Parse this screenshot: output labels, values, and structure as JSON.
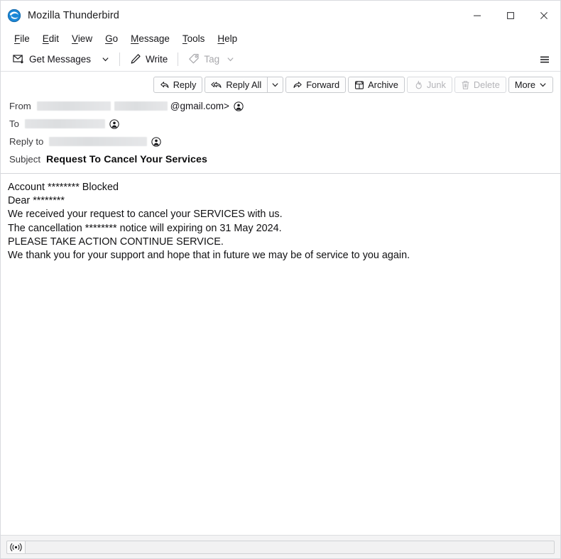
{
  "window": {
    "title": "Mozilla Thunderbird",
    "logo_icon": "thunderbird-logo-icon",
    "controls": {
      "minimize": "minimize-icon",
      "maximize": "maximize-icon",
      "close": "close-icon"
    }
  },
  "menubar": {
    "items": [
      {
        "label": "File",
        "accesskey": "F"
      },
      {
        "label": "Edit",
        "accesskey": "E"
      },
      {
        "label": "View",
        "accesskey": "V"
      },
      {
        "label": "Go",
        "accesskey": "G"
      },
      {
        "label": "Message",
        "accesskey": "M"
      },
      {
        "label": "Tools",
        "accesskey": "T"
      },
      {
        "label": "Help",
        "accesskey": "H"
      }
    ]
  },
  "toolbar": {
    "get_messages_label": "Get Messages",
    "get_messages_icon": "envelope-download-icon",
    "get_messages_chevron": "chevron-down-icon",
    "write_label": "Write",
    "write_icon": "pencil-icon",
    "tag_label": "Tag",
    "tag_icon": "tag-icon",
    "tag_chevron": "chevron-down-icon",
    "tag_disabled": true,
    "app_menu_icon": "hamburger-menu-icon"
  },
  "message_actions": [
    {
      "label": "Reply",
      "icon": "reply-arrow-icon",
      "disabled": false
    },
    {
      "label": "Reply All",
      "icon": "reply-all-arrow-icon",
      "disabled": false
    },
    {
      "label": "Forward",
      "icon": "forward-arrow-icon",
      "disabled": false
    },
    {
      "label": "Archive",
      "icon": "archive-box-icon",
      "disabled": false
    },
    {
      "label": "Junk",
      "icon": "junk-flame-icon",
      "disabled": true
    },
    {
      "label": "Delete",
      "icon": "trash-icon",
      "disabled": true
    },
    {
      "label": "More",
      "icon": "chevron-down-icon",
      "disabled": false
    }
  ],
  "headers": {
    "from_label": "From",
    "from_visible_text": "@gmail.com>",
    "from_redacted": true,
    "to_label": "To",
    "to_redacted": true,
    "reply_to_label": "Reply to",
    "reply_to_redacted": true,
    "subject_label": "Subject",
    "subject_value": "Request To Cancel Your Services",
    "contact_icon": "contact-person-icon",
    "date_redacted": true
  },
  "body": {
    "lines": [
      "Account ******** Blocked",
      "Dear ********",
      "We received your request to cancel your SERVICES with us.",
      "The cancellation ******** notice will expiring on 31 May 2024.",
      "PLEASE TAKE ACTION CONTINUE SERVICE.",
      "We thank you for your support and hope that in future we may be of service to you again."
    ]
  },
  "statusbar": {
    "online_icon": "online-connectivity-icon",
    "progress_text": ""
  },
  "colors": {
    "accent": "#0a84ff",
    "window_bg": "#ffffff",
    "toolbar_bg": "#f7f7f8",
    "status_bg": "#f3f3f4",
    "text": "#15141a",
    "disabled_text": "#b4b4b8"
  }
}
